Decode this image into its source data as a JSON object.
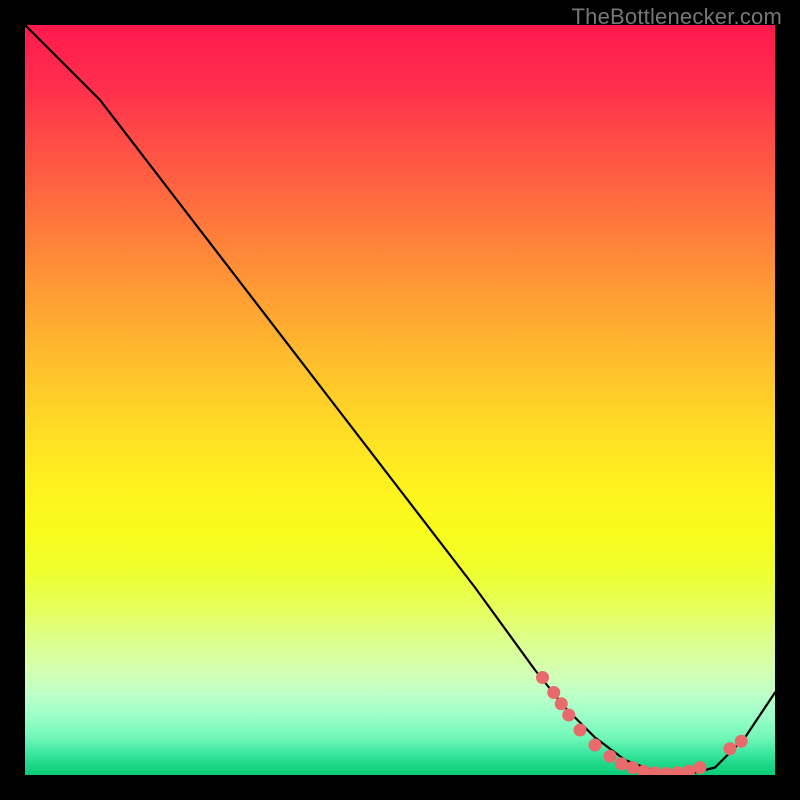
{
  "attribution": "TheBottlenecker.com",
  "chart_data": {
    "type": "line",
    "title": "",
    "xlabel": "",
    "ylabel": "",
    "xlim": [
      0,
      100
    ],
    "ylim": [
      0,
      100
    ],
    "series": [
      {
        "name": "curve",
        "x": [
          0,
          6,
          10,
          20,
          30,
          40,
          50,
          60,
          68,
          72,
          76,
          80,
          84,
          88,
          92,
          96,
          100
        ],
        "y": [
          100,
          94,
          90,
          77,
          64,
          51,
          38,
          25,
          14,
          9,
          5,
          2,
          0.5,
          0,
          1,
          5,
          11
        ]
      }
    ],
    "markers": {
      "name": "dots",
      "color": "#e86a6a",
      "points": [
        {
          "x": 69.0,
          "y": 13.0
        },
        {
          "x": 70.5,
          "y": 11.0
        },
        {
          "x": 71.5,
          "y": 9.5
        },
        {
          "x": 72.5,
          "y": 8.0
        },
        {
          "x": 74.0,
          "y": 6.0
        },
        {
          "x": 76.0,
          "y": 4.0
        },
        {
          "x": 78.0,
          "y": 2.5
        },
        {
          "x": 79.5,
          "y": 1.5
        },
        {
          "x": 81.0,
          "y": 1.0
        },
        {
          "x": 82.5,
          "y": 0.5
        },
        {
          "x": 84.0,
          "y": 0.3
        },
        {
          "x": 85.5,
          "y": 0.2
        },
        {
          "x": 87.0,
          "y": 0.3
        },
        {
          "x": 88.5,
          "y": 0.5
        },
        {
          "x": 90.0,
          "y": 1.0
        },
        {
          "x": 94.0,
          "y": 3.5
        },
        {
          "x": 95.5,
          "y": 4.5
        }
      ]
    },
    "gradient_stops": [
      {
        "pos": 0,
        "color": "#ff1a4d"
      },
      {
        "pos": 50,
        "color": "#ffd828"
      },
      {
        "pos": 75,
        "color": "#f0ff3c"
      },
      {
        "pos": 100,
        "color": "#0acb76"
      }
    ]
  }
}
